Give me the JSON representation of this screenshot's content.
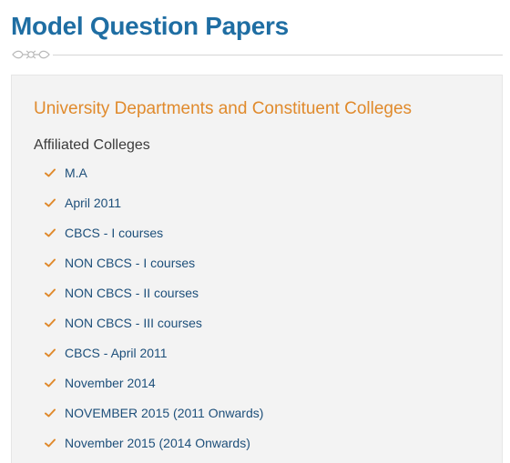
{
  "page_title": "Model Question Papers",
  "colors": {
    "title": "#1f6ea3",
    "accent": "#e08a2c",
    "link": "#1d4f7a",
    "panel_bg": "#f3f3f3"
  },
  "panel": {
    "heading": "University Departments and Constituent Colleges",
    "subheading": "Affiliated Colleges",
    "items": [
      {
        "label": "M.A",
        "icon": "check-icon"
      },
      {
        "label": "April 2011",
        "icon": "check-icon"
      },
      {
        "label": "CBCS - I courses",
        "icon": "check-icon"
      },
      {
        "label": "NON CBCS - I courses",
        "icon": "check-icon"
      },
      {
        "label": "NON CBCS - II courses",
        "icon": "check-icon"
      },
      {
        "label": "NON CBCS - III courses",
        "icon": "check-icon"
      },
      {
        "label": "CBCS - April 2011",
        "icon": "check-icon"
      },
      {
        "label": "November 2014",
        "icon": "check-icon"
      },
      {
        "label": "NOVEMBER 2015 (2011 Onwards)",
        "icon": "check-icon"
      },
      {
        "label": "November 2015 (2014 Onwards)",
        "icon": "check-icon"
      }
    ]
  }
}
